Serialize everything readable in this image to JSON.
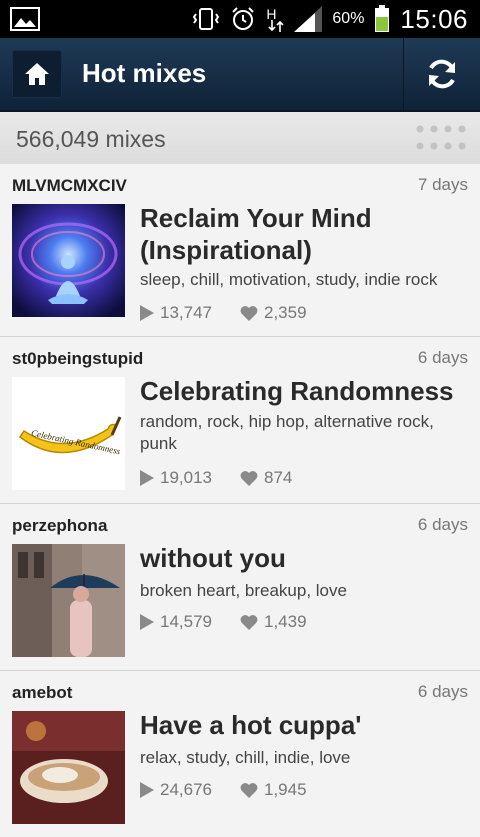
{
  "status_bar": {
    "battery": "60%",
    "time": "15:06",
    "signal_label": "H"
  },
  "header": {
    "title": "Hot mixes",
    "home_icon": "home-icon",
    "refresh_icon": "refresh-icon"
  },
  "count_bar": {
    "label": "566,049 mixes"
  },
  "mixes": [
    {
      "user": "MLVMCMXCIV",
      "age": "7 days",
      "title": "Reclaim Your Mind (Inspirational)",
      "tags": "sleep, chill, motivation, study, indie rock",
      "plays": "13,747",
      "likes": "2,359"
    },
    {
      "user": "st0pbeingstupid",
      "age": "6 days",
      "title": "Celebrating Randomness",
      "tags": "random, rock, hip hop, alternative rock, punk",
      "plays": "19,013",
      "likes": "874",
      "thumb_text": "Celebrating Randomness"
    },
    {
      "user": "perzephona",
      "age": "6 days",
      "title": "without you",
      "tags": "broken heart, breakup, love",
      "plays": "14,579",
      "likes": "1,439"
    },
    {
      "user": "amebot",
      "age": "6 days",
      "title": "Have a hot cuppa'",
      "tags": "relax, study, chill, indie, love",
      "plays": "24,676",
      "likes": "1,945"
    }
  ]
}
